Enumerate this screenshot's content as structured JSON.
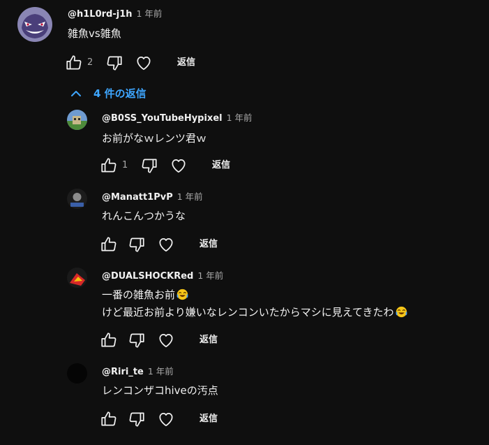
{
  "colors": {
    "background": "#0f0f0f",
    "text": "#f1f1f1",
    "secondary": "#aaaaaa",
    "link": "#3ea6ff"
  },
  "icons": [
    "thumb-up-icon",
    "thumb-down-icon",
    "heart-icon",
    "chevron-up-icon",
    "laugh-emoji-icon"
  ],
  "top_comment": {
    "author": "@h1L0rd-j1h",
    "time": "1 年前",
    "text": "雑魚vs雑魚",
    "likes": "2",
    "reply_label": "返信"
  },
  "replies_toggle": {
    "label": "4 件の返信"
  },
  "replies": [
    {
      "author": "@B0SS_YouTubeHypixel",
      "time": "1 年前",
      "lines": [
        "お前がなｗレンツ君ｗ"
      ],
      "likes": "1",
      "reply_label": "返信"
    },
    {
      "author": "@Manatt1PvP",
      "time": "1 年前",
      "lines": [
        "れんこんつかうな"
      ],
      "likes": "",
      "reply_label": "返信"
    },
    {
      "author": "@DUALSHOCKRed",
      "time": "1 年前",
      "lines": [
        "一番の雑魚お前",
        "けど最近お前より嫌いなレンコンいたからマシに見えてきたわ"
      ],
      "likes": "",
      "reply_label": "返信"
    },
    {
      "author": "@Riri_te",
      "time": "1 年前",
      "lines": [
        "レンコンザコhiveの汚点"
      ],
      "likes": "",
      "reply_label": "返信"
    }
  ]
}
